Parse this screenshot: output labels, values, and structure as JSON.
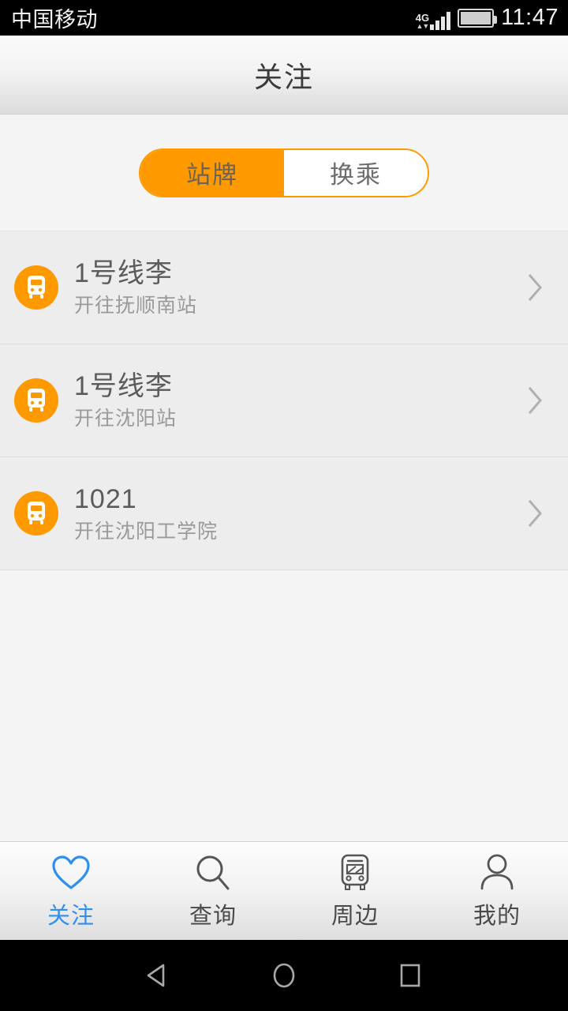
{
  "status_bar": {
    "carrier": "中国移动",
    "network_type": "4G",
    "time": "11:47",
    "signal_icon": "signal-bars-icon",
    "battery_icon": "battery-icon"
  },
  "header": {
    "title": "关注"
  },
  "segmented_control": {
    "active_color": "#FF9900",
    "options": [
      {
        "label": "站牌",
        "active": true
      },
      {
        "label": "换乘",
        "active": false
      }
    ]
  },
  "list": {
    "items": [
      {
        "icon": "bus-icon",
        "title": "1号线李",
        "subtitle": "开往抚顺南站",
        "chevron": "chevron-right-icon"
      },
      {
        "icon": "bus-icon",
        "title": "1号线李",
        "subtitle": "开往沈阳站",
        "chevron": "chevron-right-icon"
      },
      {
        "icon": "bus-icon",
        "title": "1021",
        "subtitle": "开往沈阳工学院",
        "chevron": "chevron-right-icon"
      }
    ]
  },
  "tab_bar": {
    "active_color": "#2f8ff0",
    "inactive_color": "#4a4a4a",
    "tabs": [
      {
        "label": "关注",
        "icon": "heart-icon",
        "active": true
      },
      {
        "label": "查询",
        "icon": "search-icon",
        "active": false
      },
      {
        "label": "周边",
        "icon": "bus-icon",
        "active": false
      },
      {
        "label": "我的",
        "icon": "person-icon",
        "active": false
      }
    ]
  },
  "android_nav": {
    "back": "back-triangle-icon",
    "home": "home-circle-icon",
    "recents": "recents-square-icon"
  }
}
